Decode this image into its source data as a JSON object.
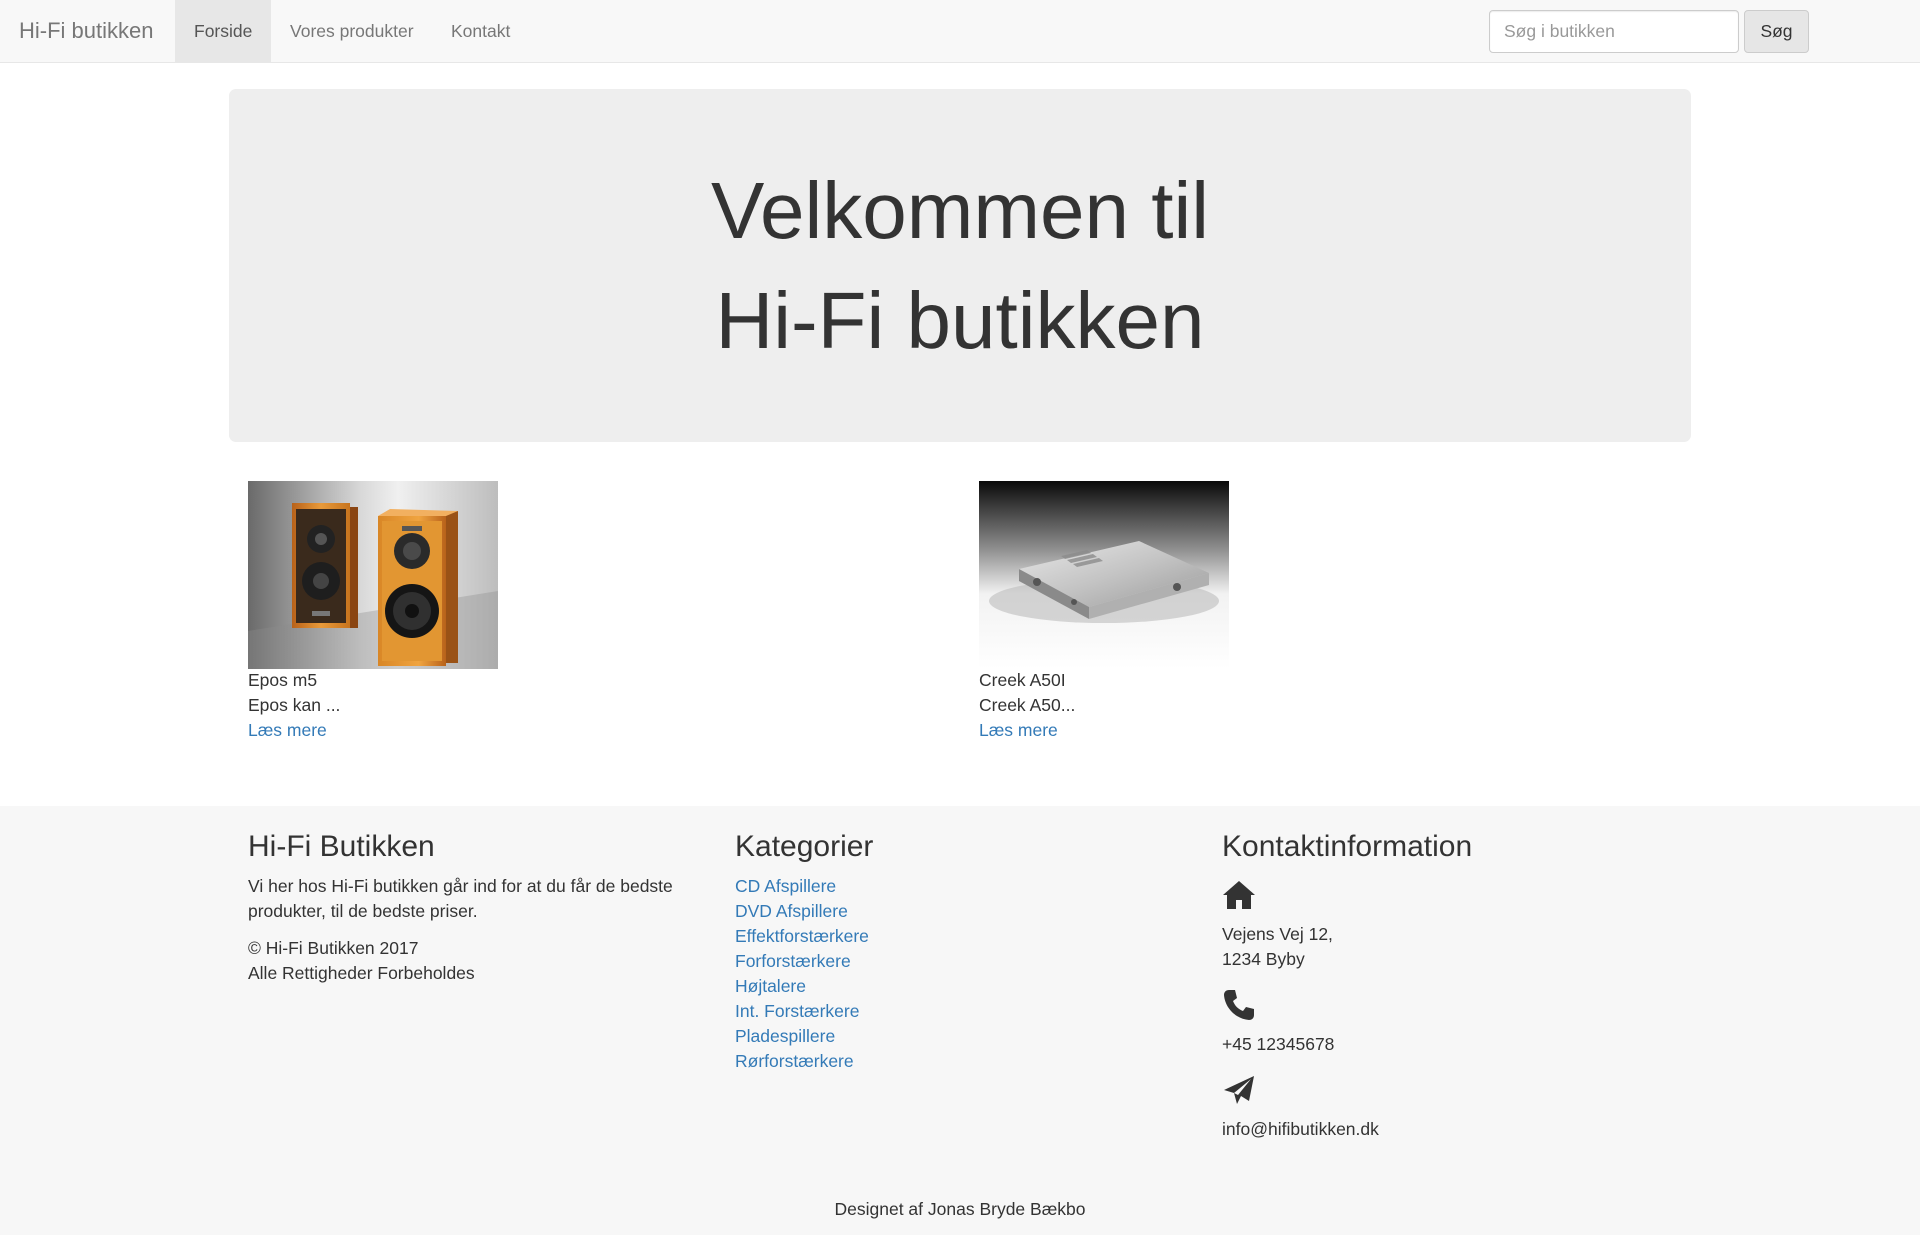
{
  "nav": {
    "brand": "Hi-Fi butikken",
    "items": [
      {
        "label": "Forside",
        "active": true
      },
      {
        "label": "Vores produkter",
        "active": false
      },
      {
        "label": "Kontakt",
        "active": false
      }
    ],
    "search_placeholder": "Søg i butikken",
    "search_button": "Søg"
  },
  "hero": {
    "line1": "Velkommen til",
    "line2": "Hi-Fi butikken"
  },
  "products": [
    {
      "name": "Epos m5",
      "desc": "Epos kan ...",
      "link": "Læs mere",
      "image": "speakers-image"
    },
    {
      "name": "Creek A50I",
      "desc": "Creek A50...",
      "link": "Læs mere",
      "image": "amplifier-image"
    }
  ],
  "footer": {
    "about": {
      "title": "Hi-Fi Butikken",
      "text": "Vi her hos Hi-Fi butikken går ind for at du får de bedste produkter, til de bedste priser.",
      "copyright": "© Hi-Fi Butikken 2017",
      "rights": "Alle Rettigheder Forbeholdes"
    },
    "categories": {
      "title": "Kategorier",
      "items": [
        "CD Afspillere",
        "DVD Afspillere",
        "Effektforstærkere",
        "Forforstærkere",
        "Højtalere",
        "Int. Forstærkere",
        "Pladespillere",
        "Rørforstærkere"
      ]
    },
    "contact": {
      "title": "Kontaktinformation",
      "address_line1": "Vejens Vej 12,",
      "address_line2": "1234 Byby",
      "phone": "+45 12345678",
      "email": "info@hifibutikken.dk",
      "icons": [
        "home-icon",
        "phone-icon",
        "send-icon"
      ]
    },
    "credit": "Designet af Jonas Bryde Bækbo"
  },
  "colors": {
    "link": "#337ab7",
    "navbar_bg": "#f8f8f8",
    "hero_bg": "#eeeeee",
    "footer_bg": "#f7f7f7"
  }
}
